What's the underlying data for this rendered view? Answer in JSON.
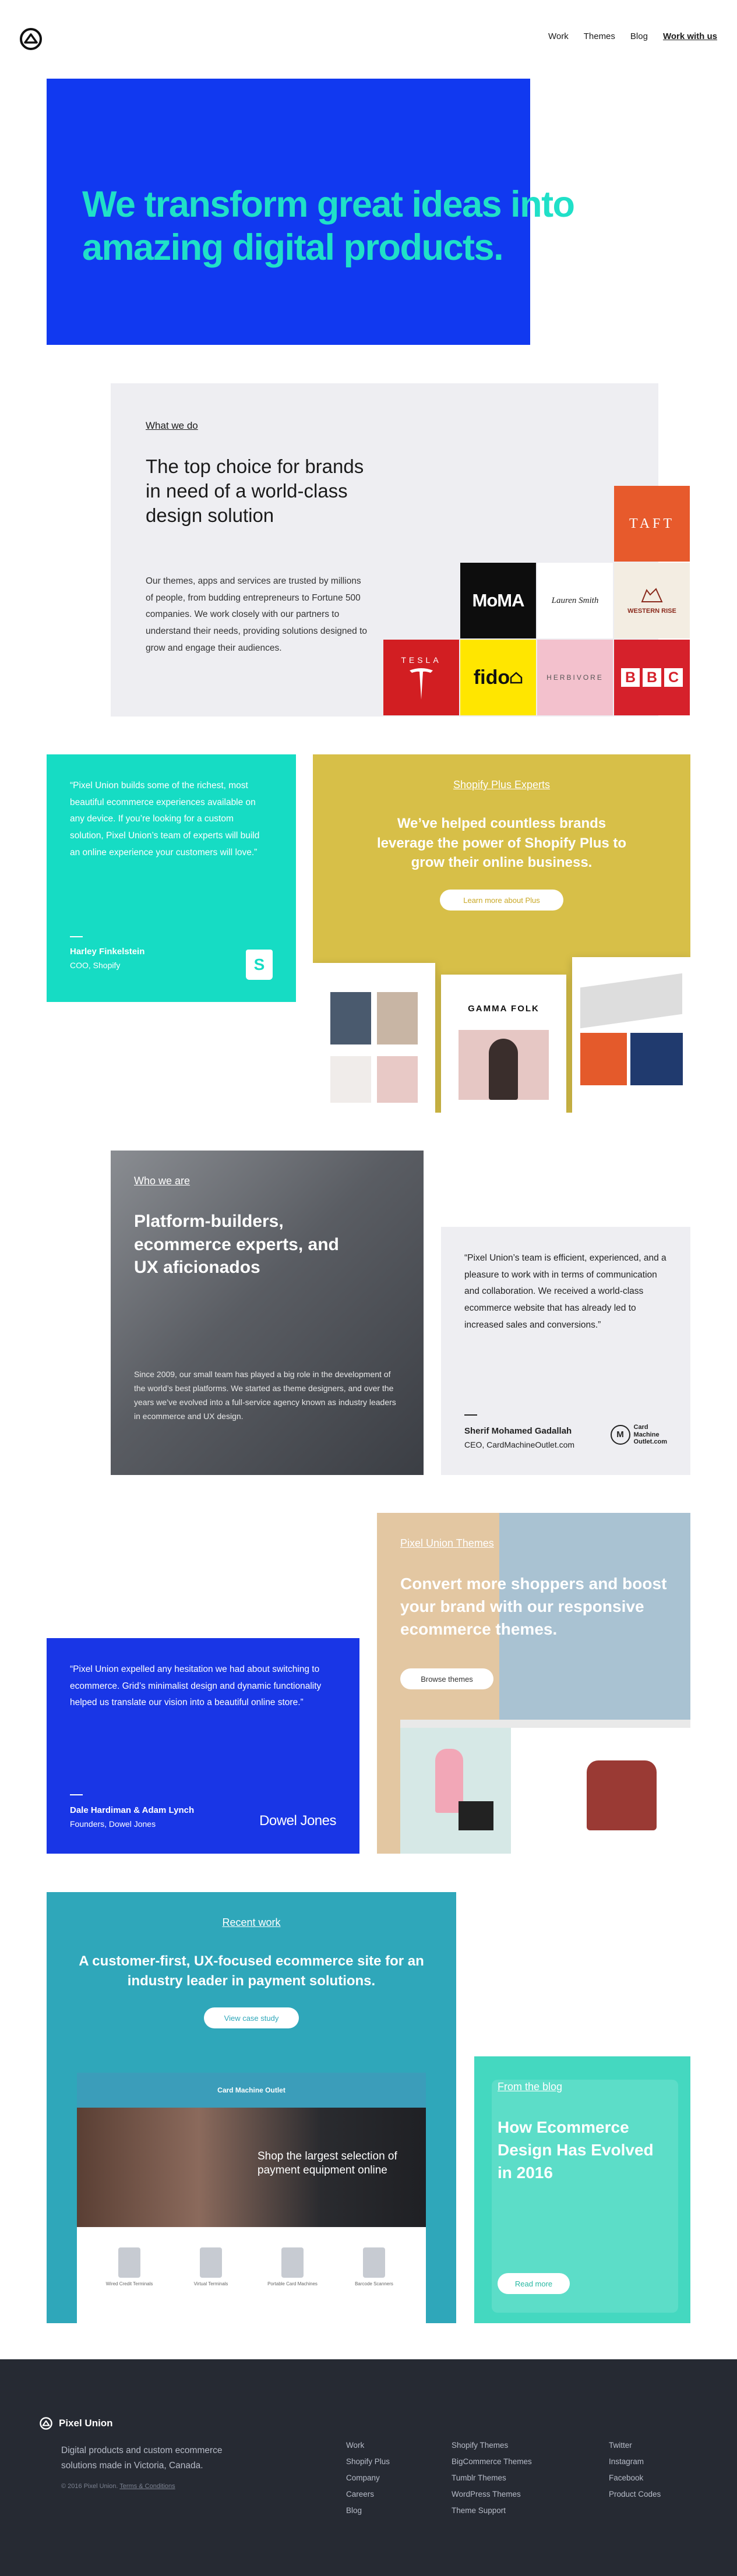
{
  "nav": {
    "items": [
      "Work",
      "Themes",
      "Blog"
    ],
    "cta": "Work with us"
  },
  "hero": {
    "title": "We transform great ideas into amazing digital products."
  },
  "what_we_do": {
    "label": "What we do",
    "title": "The top choice for brands in need of a world-class design solution",
    "text": "Our themes, apps and services are trusted by millions of people, from budding entrepreneurs to Fortune 500 companies. We work closely with our partners to understand their needs, providing solutions designed to grow and engage their audiences.",
    "clients": {
      "taft": "TAFT",
      "moma": "MoMA",
      "lauren": "Lauren Smith",
      "western": "WESTERN RISE",
      "tesla": "TESLA",
      "fido": "fido",
      "herbivore": "HERBIVORE",
      "bbc": [
        "B",
        "B",
        "C"
      ]
    }
  },
  "quote_shopify": {
    "text": "“Pixel Union builds some of the richest, most beautiful ecommerce experiences available on any device. If you’re looking for a custom solution, Pixel Union’s team of experts will build an online experience your customers will love.”",
    "name": "Harley Finkelstein",
    "role": "COO, Shopify",
    "logo_letter": "S"
  },
  "shopify_plus": {
    "label": "Shopify Plus Experts",
    "title": "We’ve helped countless brands leverage the power of Shopify Plus to grow their online business.",
    "button": "Learn more about Plus",
    "screens": {
      "gamma": "GAMMA FOLK"
    }
  },
  "who_we_are": {
    "label": "Who we are",
    "title": "Platform-builders, ecommerce experts, and UX aficionados",
    "text": "Since 2009, our small team has played a big role in the development of the world’s best platforms. We started as theme designers, and over the years we’ve evolved into a full-service agency known as industry leaders in ecommerce and UX design."
  },
  "quote_cmo": {
    "text": "“Pixel Union’s team is efficient, experienced, and a pleasure to work with in terms of communication and collaboration. We received a world-class ecommerce website that has already led to increased sales and conversions.”",
    "name": "Sherif Mohamed Gadallah",
    "role": "CEO, CardMachineOutlet.com",
    "logo_letter": "M",
    "logo_lines": [
      "Card",
      "Machine",
      "Outlet.com"
    ]
  },
  "quote_dowel": {
    "text": "“Pixel Union expelled any hesitation we had about switching to ecommerce. Grid’s minimalist design and dynamic functionality helped us translate our vision into a beautiful online store.”",
    "name": "Dale Hardiman & Adam Lynch",
    "role": "Founders, Dowel Jones",
    "logo": "Dowel Jones"
  },
  "themes": {
    "label": "Pixel Union Themes",
    "title": "Convert more shoppers and boost your brand with our responsive ecommerce themes.",
    "button": "Browse themes"
  },
  "recent_work": {
    "label": "Recent work",
    "title": "A customer-first, UX-focused ecommerce site for an industry leader in payment solutions.",
    "button": "View case study",
    "site": {
      "brand": "Card Machine Outlet",
      "hero": "Shop the largest selection of payment equipment online",
      "products": [
        "Wired Credit Terminals",
        "Virtual Terminals",
        "Portable Card Machines",
        "Barcode Scanners"
      ]
    }
  },
  "blog": {
    "label": "From the blog",
    "title": "How Ecommerce Design Has Evolved in 2016",
    "button": "Read more"
  },
  "footer": {
    "brand": "Pixel Union",
    "description": "Digital products and custom ecommerce solutions made in Victoria, Canada.",
    "copyright": "© 2016 Pixel Union.",
    "terms": "Terms & Conditions",
    "col1": [
      "Work",
      "Shopify Plus",
      "Company",
      "Careers",
      "Blog"
    ],
    "col2": [
      "Shopify Themes",
      "BigCommerce Themes",
      "Tumblr Themes",
      "WordPress Themes",
      "Theme Support"
    ],
    "col3": [
      "Twitter",
      "Instagram",
      "Facebook",
      "Product Codes"
    ]
  },
  "colors": {
    "hero_blue": "#1139f0",
    "accent_teal": "#20e0c8",
    "plus_gold": "#d7bf48",
    "dowel_blue": "#1936e6",
    "recent_teal": "#2fa7ba",
    "footer_dark": "#262a33"
  }
}
